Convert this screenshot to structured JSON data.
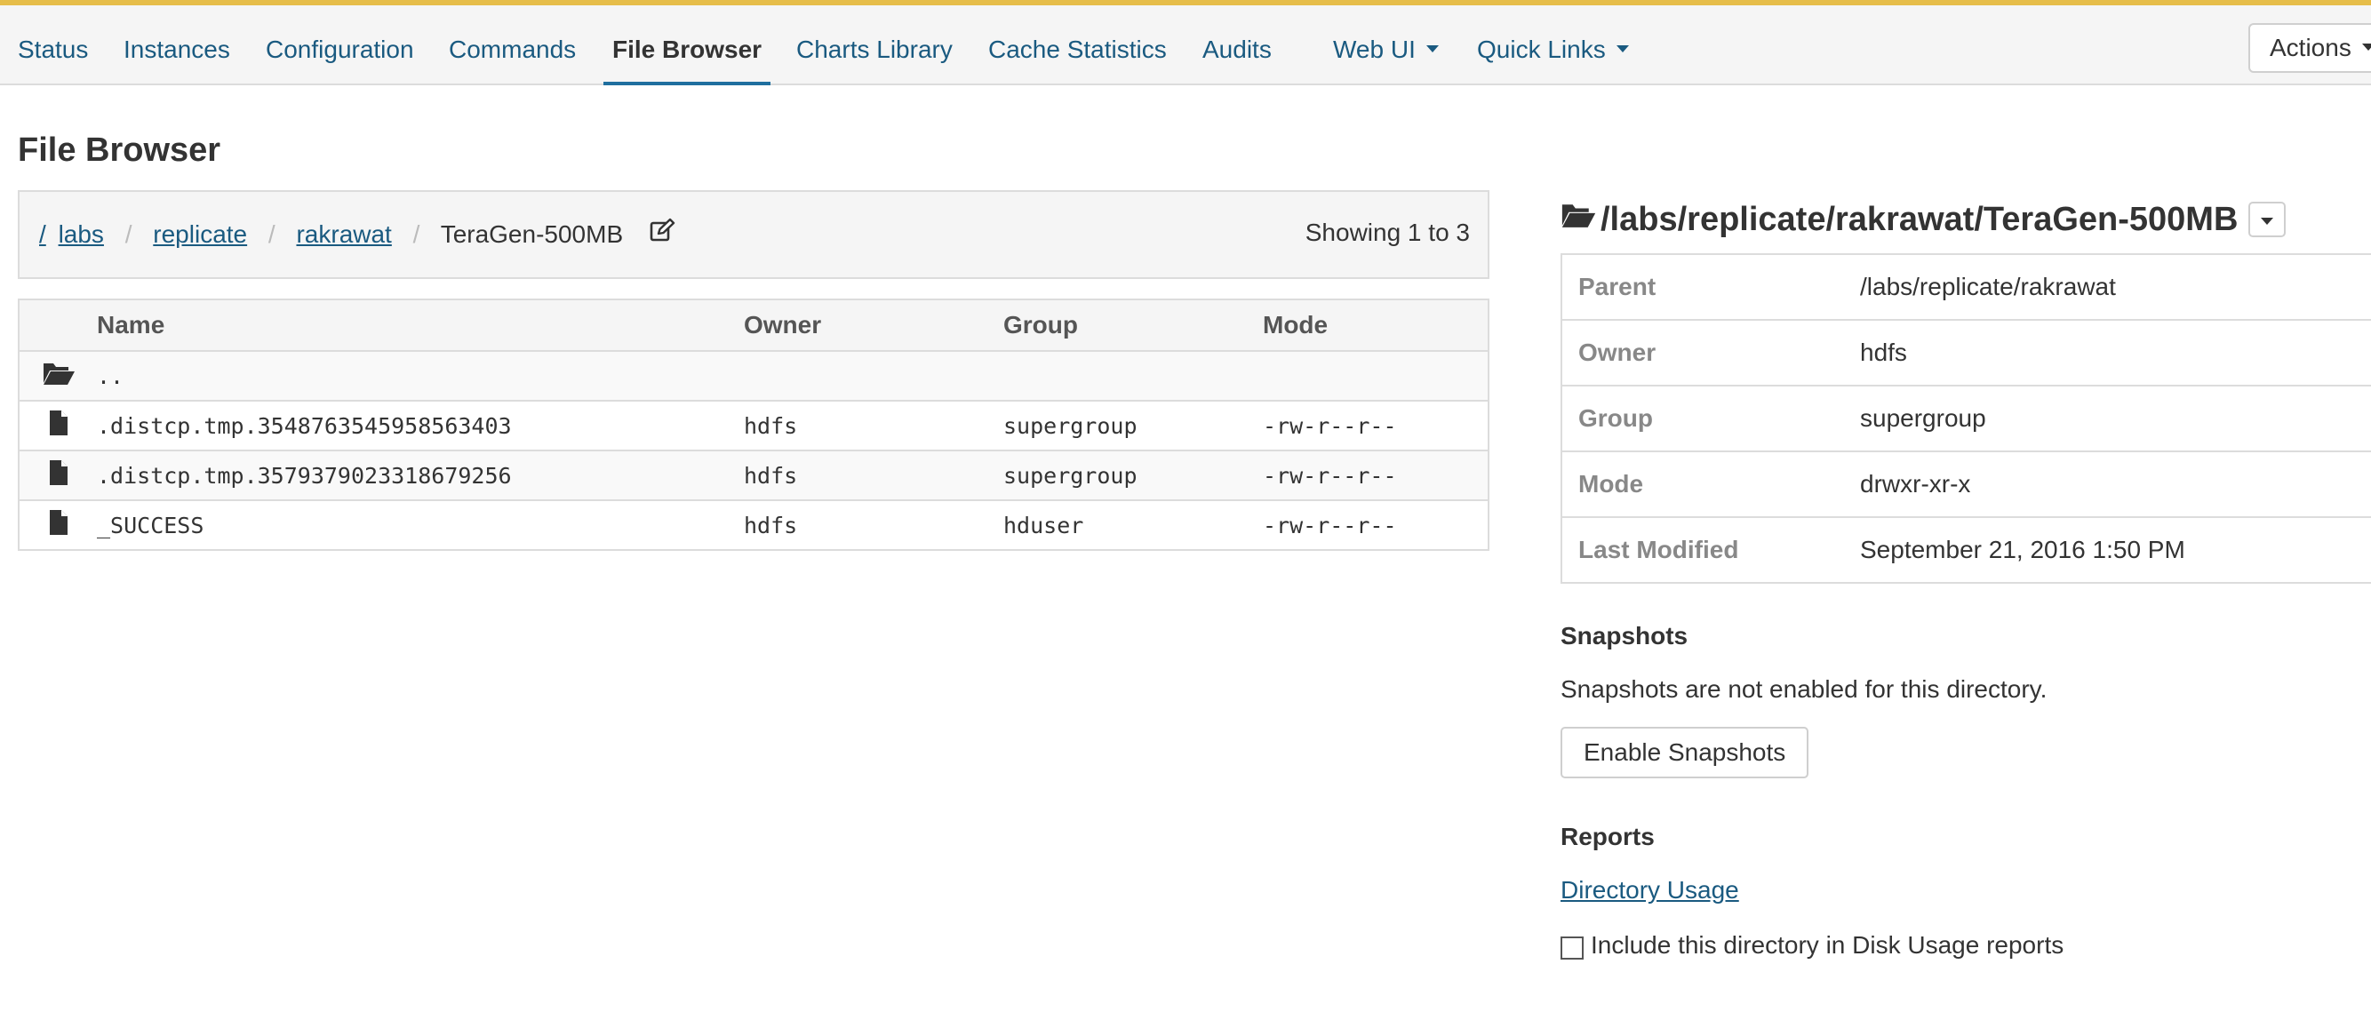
{
  "nav": {
    "tabs": [
      {
        "label": "Status"
      },
      {
        "label": "Instances"
      },
      {
        "label": "Configuration"
      },
      {
        "label": "Commands"
      },
      {
        "label": "File Browser",
        "active": true
      },
      {
        "label": "Charts Library"
      },
      {
        "label": "Cache Statistics"
      },
      {
        "label": "Audits"
      },
      {
        "label": "Web UI",
        "dropdown": true
      },
      {
        "label": "Quick Links",
        "dropdown": true
      }
    ],
    "actions_label": "Actions"
  },
  "page": {
    "title": "File Browser"
  },
  "breadcrumb": {
    "root": "/",
    "items": [
      "labs",
      "replicate",
      "rakrawat"
    ],
    "separator": "/",
    "current": "TeraGen-500MB",
    "showing": "Showing 1 to 3"
  },
  "table": {
    "headers": [
      "Name",
      "Owner",
      "Group",
      "Mode"
    ],
    "rows": [
      {
        "icon": "folder-open-icon",
        "name": "..",
        "owner": "",
        "group": "",
        "mode": ""
      },
      {
        "icon": "file-icon",
        "name": ".distcp.tmp.3548763545958563403",
        "owner": "hdfs",
        "group": "supergroup",
        "mode": "-rw-r--r--"
      },
      {
        "icon": "file-icon",
        "name": ".distcp.tmp.3579379023318679256",
        "owner": "hdfs",
        "group": "supergroup",
        "mode": "-rw-r--r--"
      },
      {
        "icon": "file-icon",
        "name": "_SUCCESS",
        "owner": "hdfs",
        "group": "hduser",
        "mode": "-rw-r--r--"
      }
    ]
  },
  "details": {
    "path": "/labs/replicate/rakrawat/TeraGen-500MB",
    "props": [
      {
        "key": "Parent",
        "value": "/labs/replicate/rakrawat"
      },
      {
        "key": "Owner",
        "value": "hdfs"
      },
      {
        "key": "Group",
        "value": "supergroup"
      },
      {
        "key": "Mode",
        "value": "drwxr-xr-x"
      },
      {
        "key": "Last Modified",
        "value": "September 21, 2016 1:50 PM"
      }
    ],
    "snapshots_heading": "Snapshots",
    "snapshots_text": "Snapshots are not enabled for this directory.",
    "enable_snapshots_label": "Enable Snapshots",
    "reports_heading": "Reports",
    "directory_usage_link": "Directory Usage",
    "disk_usage_checkbox_label": "Include this directory in Disk Usage reports",
    "disk_usage_checked": false
  },
  "colors": {
    "accent_stripe": "#e6bd4a",
    "link": "#1a5a80",
    "active_underline": "#1f6f9f"
  }
}
